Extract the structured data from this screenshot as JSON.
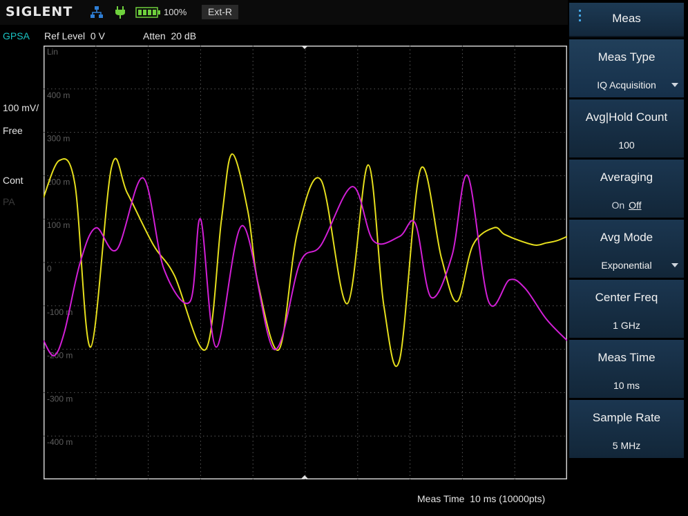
{
  "status_bar": {
    "brand": "SIGLENT",
    "battery_percent": "100%",
    "reference": "Ext-R",
    "icons": {
      "network": "network-icon",
      "power": "power-plug-icon",
      "battery": "battery-icon"
    }
  },
  "info_bar": {
    "mode": "GPSA",
    "ref_level": "Ref Level  0 V",
    "atten": "Atten  20 dB"
  },
  "side_labels": {
    "scale": "100 mV/",
    "trigger": "Free",
    "sweep": "Cont",
    "pa": "PA"
  },
  "colors": {
    "trace_i": "#e6df1d",
    "trace_q": "#d21fd6",
    "mode_label": "#19c3c3",
    "menu_bg": "#1b3650"
  },
  "chart_data": {
    "type": "line",
    "title": "",
    "scale_type": "Lin",
    "x_range": [
      0,
      10
    ],
    "x_unit": "ms",
    "ylim": [
      -500,
      500
    ],
    "y_unit": "mV",
    "y_tick_labels": [
      "Lin",
      "400 m",
      "300 m",
      "200 m",
      "100 m",
      "0",
      "-100 m",
      "-200 m",
      "-300 m",
      "-400 m"
    ],
    "y_tick_values": [
      500,
      400,
      300,
      200,
      100,
      0,
      -100,
      -200,
      -300,
      -400
    ],
    "grid": true,
    "grid_divisions": [
      10,
      10
    ],
    "series": [
      {
        "color": "#e6df1d",
        "x": [
          0,
          0.3,
          0.6,
          0.9,
          1.3,
          1.6,
          2.1,
          2.5,
          3.1,
          3.4,
          3.6,
          3.9,
          4.1,
          4.5,
          4.85,
          5.3,
          5.8,
          6.2,
          6.5,
          6.8,
          7.2,
          7.6,
          7.9,
          8.2,
          8.6,
          8.8,
          9.1,
          9.4,
          9.6,
          9.8,
          10
        ],
        "values": [
          150,
          235,
          180,
          -195,
          220,
          160,
          40,
          -30,
          -200,
          100,
          250,
          120,
          -50,
          -200,
          70,
          190,
          -95,
          225,
          -100,
          -225,
          215,
          10,
          -90,
          40,
          80,
          65,
          50,
          40,
          45,
          50,
          60
        ]
      },
      {
        "color": "#d21fd6",
        "x": [
          0,
          0.2,
          0.4,
          0.7,
          1.0,
          1.4,
          1.9,
          2.3,
          2.8,
          3.0,
          3.3,
          3.8,
          4.4,
          4.9,
          5.3,
          5.9,
          6.3,
          6.8,
          7.1,
          7.4,
          7.8,
          8.1,
          8.5,
          8.9,
          9.2,
          9.6,
          10
        ],
        "values": [
          -180,
          -215,
          -160,
          0,
          80,
          30,
          195,
          -15,
          -90,
          100,
          -195,
          85,
          -200,
          0,
          40,
          175,
          50,
          60,
          90,
          -80,
          15,
          200,
          -90,
          -40,
          -60,
          -130,
          -180
        ]
      }
    ]
  },
  "footer": {
    "meas_time_label": "Meas Time",
    "meas_time_value": "10 ms (10000pts)"
  },
  "menu": {
    "title": "Meas",
    "items": [
      {
        "label": "Meas Type",
        "value": "IQ Acquisition",
        "dropdown": true
      },
      {
        "label": "Avg|Hold Count",
        "value": "100"
      },
      {
        "label": "Averaging",
        "on_label": "On",
        "off_label": "Off",
        "selected": "Off"
      },
      {
        "label": "Avg Mode",
        "value": "Exponential",
        "dropdown": true
      },
      {
        "label": "Center Freq",
        "value": "1 GHz"
      },
      {
        "label": "Meas Time",
        "value": "10 ms"
      },
      {
        "label": "Sample Rate",
        "value": "5 MHz"
      }
    ]
  }
}
